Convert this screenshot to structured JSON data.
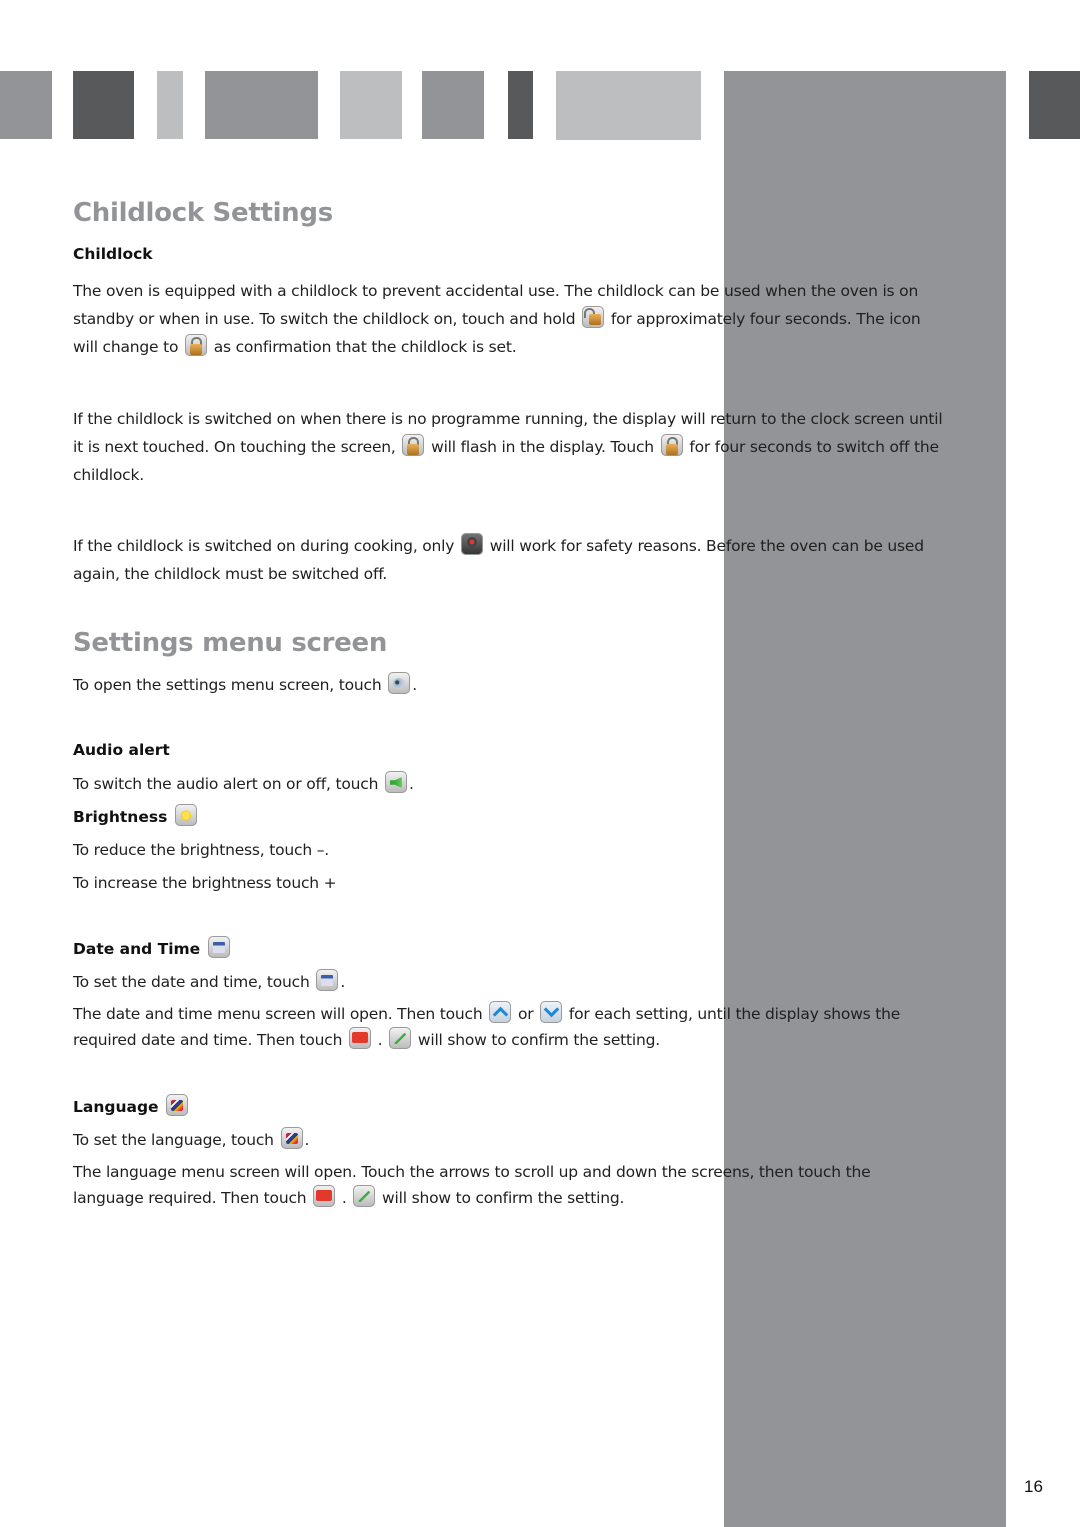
{
  "header_blocks": [
    {
      "shade": "mid"
    },
    {
      "shade": "dark"
    },
    {
      "shade": "light"
    },
    {
      "shade": "mid"
    },
    {
      "shade": "light"
    },
    {
      "shade": "mid"
    },
    {
      "shade": "dark"
    },
    {
      "shade": "light"
    },
    {
      "shade": "mid"
    },
    {
      "shade": "dark"
    }
  ],
  "childlock_section": {
    "title": "Childlock Settings",
    "subheading": "Childlock",
    "para1": {
      "a": "The oven is equipped with a childlock to prevent accidental use.  The childlock can be used when the oven is on standby or when in use.  To switch the childlock on, touch and hold ",
      "icon1": "unlock-icon",
      "b": " for approximately four seconds.  The icon will change to ",
      "icon2": "lock-icon",
      "c": " as confirmation that the childlock is set."
    },
    "para2": {
      "a": "If the childlock is switched on when there is no programme running, the display will return to the clock screen until it is next touched.  On touching the screen, ",
      "icon1": "lock-icon",
      "b": " will flash in the display.  Touch ",
      "icon2": "lock-icon",
      "c": " for four seconds to switch off the childlock."
    },
    "para3": {
      "a": "If the childlock is switched on during cooking, only ",
      "icon1": "power-off-icon",
      "b": " will work for safety reasons.  Before the oven can be used again, the childlock must be switched off."
    }
  },
  "settings_section": {
    "title": "Settings menu screen",
    "intro": {
      "a": "To open the settings menu screen, touch ",
      "icon": "settings-icon",
      "b": "."
    },
    "audio": {
      "heading": "Audio alert",
      "text_a": "To switch the audio alert on or off, touch ",
      "icon": "speaker-icon",
      "text_b": "."
    },
    "brightness": {
      "heading": "Brightness",
      "icon": "brightness-icon",
      "line1": "To reduce the brightness, touch –.",
      "line2": "To increase the brightness touch +"
    },
    "datetime": {
      "heading": "Date and Time",
      "icon": "date-time-icon",
      "line1_a": "To set the date and time, touch ",
      "line1_b": ".",
      "p_a": "The date and time menu screen will open.  Then touch ",
      "up_icon": "arrow-up-icon",
      "p_or": " or ",
      "down_icon": "arrow-down-icon",
      "p_b": " for each setting, until the display shows the required date and time.  Then touch ",
      "ok_icon": "ok-icon",
      "p_c": " .  ",
      "check_icon": "check-icon",
      "p_d": " will show to confirm the setting."
    },
    "language": {
      "heading": "Language",
      "icon": "language-flags-icon",
      "line1_a": "To set the language, touch ",
      "line1_b": ".",
      "p_a": "The language menu screen will open.  Touch the arrows to scroll up and down the screens, then touch the language required.  Then touch ",
      "ok_icon": "ok-icon",
      "p_b": " .  ",
      "check_icon": "check-icon",
      "p_c": " will show to confirm the setting."
    }
  },
  "page_number": "16",
  "colors": {
    "light": "#bdbebf",
    "mid": "#939497",
    "dark": "#58595b"
  }
}
